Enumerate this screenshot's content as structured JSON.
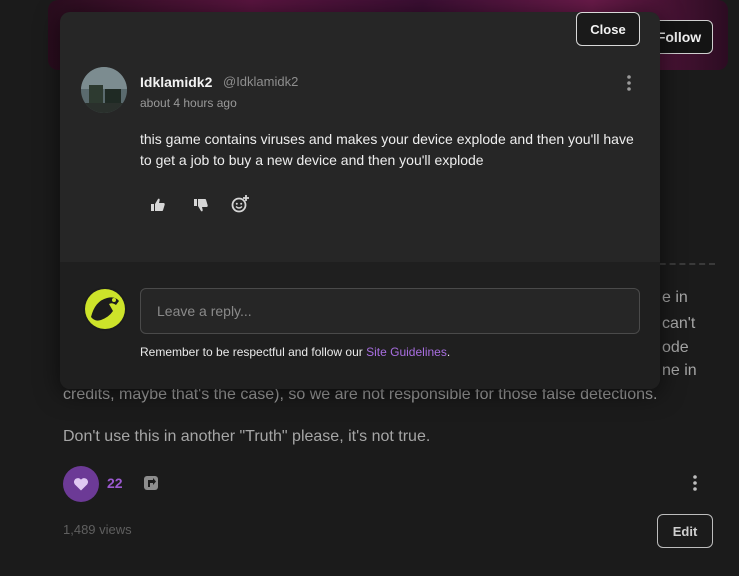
{
  "background": {
    "follow_label": "Follow",
    "text_fragments": {
      "frag1": "e in",
      "frag2": "can't",
      "frag3": "ode",
      "frag4": "ne in"
    },
    "paragraph_line": "credits, maybe that's the case), so we are not responsible for those false detections.",
    "paragraph_2": "Don't use this in another \"Truth\" please, it's not true.",
    "like_count": "22",
    "views": "1,489 views",
    "edit_label": "Edit"
  },
  "modal": {
    "close_label": "Close",
    "comment": {
      "username": "Idklamidk2",
      "handle": "@Idklamidk2",
      "timestamp": "about 4 hours ago",
      "text": "this game contains viruses and makes your device explode and then you'll have  to get a job to buy a new device and then you'll explode"
    },
    "reply": {
      "placeholder": "Leave a reply...",
      "guideline_prefix": "Remember to be respectful and follow our ",
      "guideline_link": "Site Guidelines",
      "guideline_suffix": "."
    }
  },
  "colors": {
    "accent": "#a86ee0",
    "like_bg": "#6c3a96",
    "modal_bg": "#262626",
    "page_bg": "#1b1b1b"
  },
  "icons": [
    "thumbs-up-icon",
    "thumbs-down-icon",
    "add-reaction-icon",
    "kebab-menu-icon",
    "heart-icon",
    "share-icon"
  ]
}
